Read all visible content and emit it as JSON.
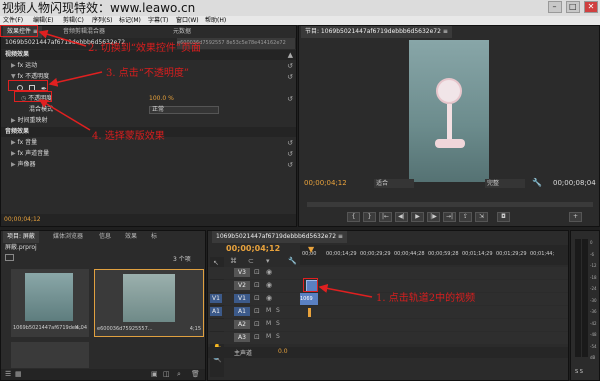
{
  "window": {
    "title": "视频人物闪现特效：www.leawo.cn",
    "min": "–",
    "max": "□",
    "close": "✕"
  },
  "menu": [
    "文件(F)",
    "编辑(E)",
    "剪辑(C)",
    "序列(S)",
    "标记(M)",
    "字幕(T)",
    "窗口(W)",
    "帮助(H)"
  ],
  "effect_controls": {
    "tabs": [
      "效果控件 ≡",
      "音频剪辑混合器",
      "元数据"
    ],
    "clip_name": "1069b5021447af6719debbb6d5632e72",
    "sequence_clip": "e600036d7592557 8e53c5e78e414162e72",
    "sections": {
      "video_effects": "视频效果",
      "motion": "fx 运动",
      "opacity": "fx 不透明度",
      "opacity_prop": "不透明度",
      "opacity_value": "100.0 %",
      "blend_mode": "混合模式",
      "blend_value": "正常",
      "time_remap": "时间重映射",
      "audio_effects": "音频效果",
      "volume": "fx 音量",
      "channel_volume": "fx 声道音量",
      "panner": "声像器"
    },
    "timecode": "00;00;04;12"
  },
  "program": {
    "tab": "节目: 1069b5021447af6719debbb6d5632e72 ≡",
    "timecode": "00;00;04;12",
    "fit": "适合",
    "quality": "完整",
    "duration": "00;00;08;04"
  },
  "project": {
    "tabs": [
      "项目: 屏蔽",
      "媒体浏览器",
      "信息",
      "效果",
      "标"
    ],
    "project_file": "屏蔽.prproj",
    "count": "3 个项",
    "items": [
      {
        "name": "1069b5021447af6719deb...",
        "duration": "4;04"
      },
      {
        "name": "e600036d75925557...",
        "duration": "4;15"
      }
    ]
  },
  "timeline": {
    "tab": "1069b5021447af6719debbb6d5632e72 ≡",
    "timecode": "00;00;04;12",
    "ruler": [
      "00;00",
      "00;00;14;29",
      "00;00;29;29",
      "00;00;44;28",
      "00;00;59;28",
      "00;01;14;29",
      "00;01;29;29",
      "00;01;44;"
    ],
    "tracks": [
      "V3",
      "V2",
      "V1",
      "A1",
      "A2",
      "A3"
    ],
    "source_left": [
      "",
      "",
      "V1",
      "A1",
      "",
      ""
    ],
    "clip_v1": "1069",
    "master": "主声道",
    "master_value": "0.0"
  },
  "audio_meter": {
    "labels": [
      "0",
      "-6",
      "-12",
      "-18",
      "-24",
      "-30",
      "-36",
      "-42",
      "-48",
      "-54",
      "dB"
    ],
    "bottom": "S S"
  },
  "annotations": {
    "step1": "1. 点击轨道2中的视频",
    "step2": "2. 切换到“效果控件”页面",
    "step3": "3. 点击“不透明度”",
    "step4": "4. 选择蒙版效果"
  },
  "colors": {
    "annotation": "#e02020",
    "timecode": "#e8a23c",
    "clip": "#5a80c2"
  }
}
